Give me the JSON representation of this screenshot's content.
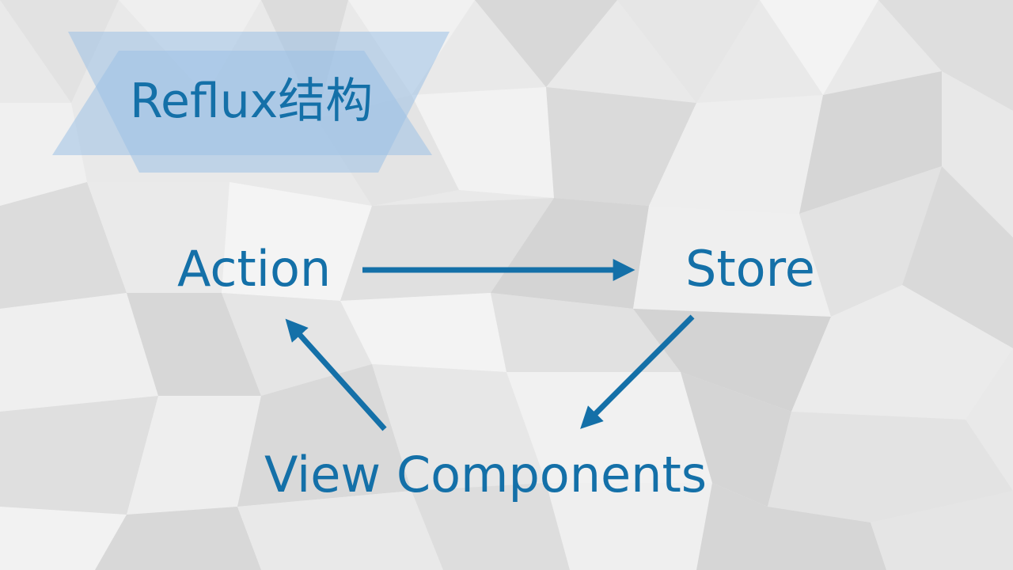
{
  "slide": {
    "title": "Reflux结构"
  },
  "diagram": {
    "nodes": {
      "action": "Action",
      "store": "Store",
      "view": "View Components"
    },
    "edges": [
      {
        "from": "action",
        "to": "store"
      },
      {
        "from": "store",
        "to": "view"
      },
      {
        "from": "view",
        "to": "action"
      }
    ]
  },
  "colors": {
    "text": "#1470a8",
    "arrow": "#1470a8",
    "banner": "#9cc1e6"
  }
}
